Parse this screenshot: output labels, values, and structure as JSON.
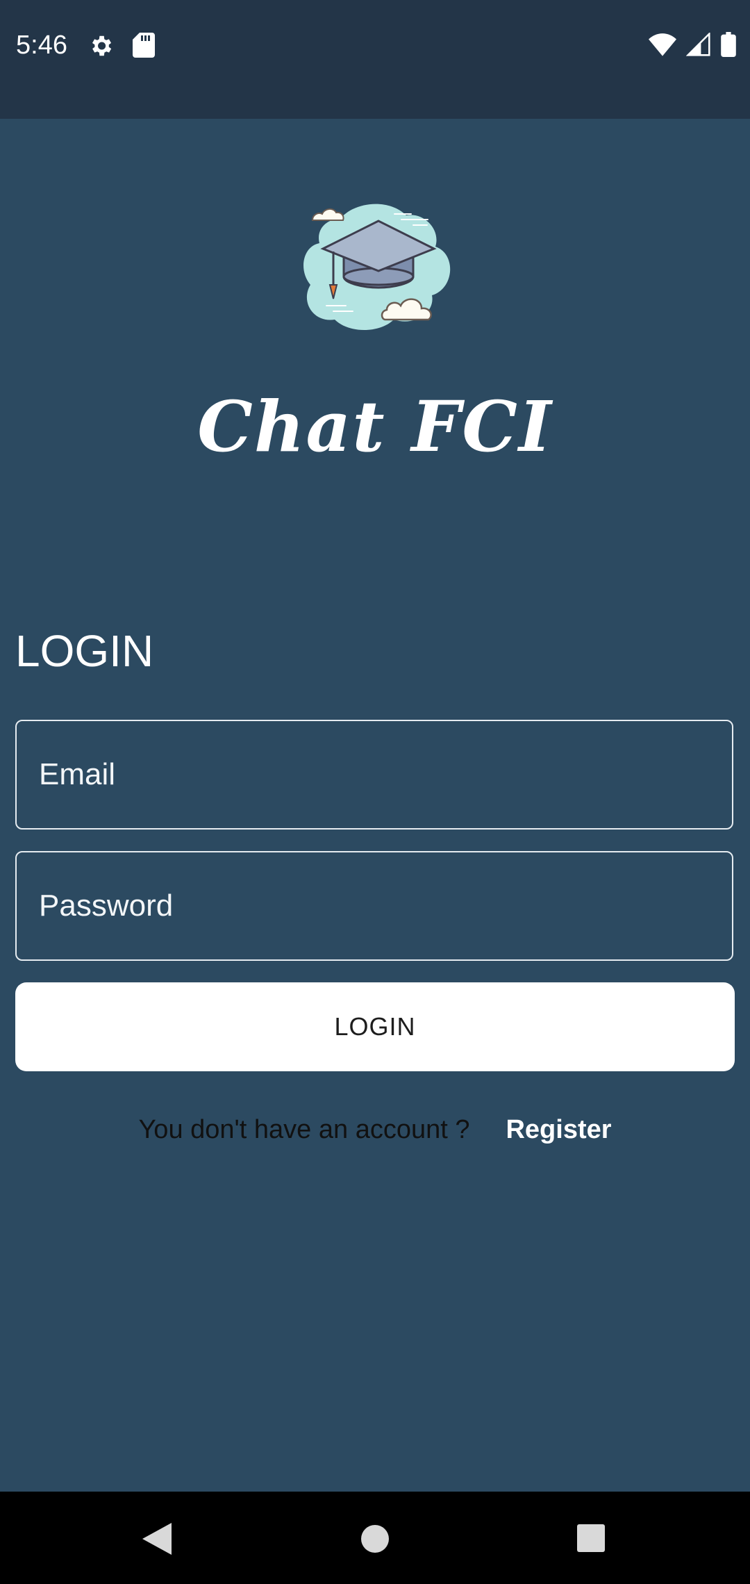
{
  "status_bar": {
    "time": "5:46",
    "left_icons": [
      "gear-icon",
      "sd-card-icon"
    ],
    "right_icons": [
      "wifi-icon",
      "signal-icon",
      "battery-icon"
    ]
  },
  "app": {
    "title": "Chat FCI",
    "logo": "graduation-cap-cloud-logo"
  },
  "login": {
    "heading": "LOGIN",
    "email_placeholder": "Email",
    "password_placeholder": "Password",
    "button_label": "LOGIN"
  },
  "register": {
    "prompt": "You don't have an account ?",
    "link_label": "Register"
  },
  "nav_bar": {
    "icons": [
      "back-icon",
      "home-icon",
      "recents-icon"
    ]
  },
  "colors": {
    "background": "#2c4a61",
    "status_bar": "#233548",
    "button": "#ffffff"
  }
}
